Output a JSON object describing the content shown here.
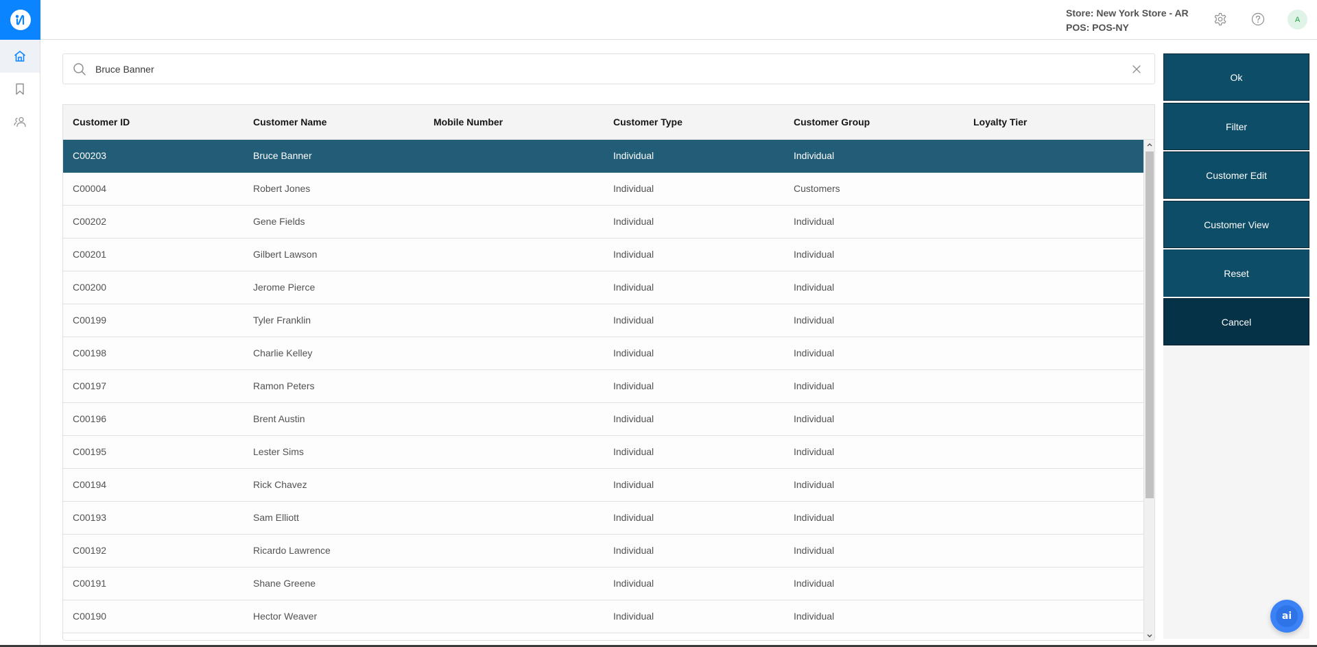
{
  "header": {
    "store_label": "Store: New York Store - AR",
    "pos_label": "POS: POS-NY",
    "avatar_initial": "A"
  },
  "sidebar": {
    "items": [
      {
        "name": "home",
        "icon": "home-icon",
        "active": true
      },
      {
        "name": "bookmarks",
        "icon": "bookmark-icon",
        "active": false
      },
      {
        "name": "customers",
        "icon": "users-icon",
        "active": false
      }
    ]
  },
  "search": {
    "value": "Bruce Banner",
    "placeholder": ""
  },
  "table": {
    "columns": [
      "Customer ID",
      "Customer Name",
      "Mobile Number",
      "Customer Type",
      "Customer Group",
      "Loyalty Tier"
    ],
    "selected_index": 0,
    "rows": [
      [
        "C00203",
        "Bruce Banner",
        "",
        "Individual",
        "Individual",
        ""
      ],
      [
        "C00004",
        "Robert Jones",
        "",
        "Individual",
        "Customers",
        ""
      ],
      [
        "C00202",
        "Gene Fields",
        "",
        "Individual",
        "Individual",
        ""
      ],
      [
        "C00201",
        "Gilbert Lawson",
        "",
        "Individual",
        "Individual",
        ""
      ],
      [
        "C00200",
        "Jerome Pierce",
        "",
        "Individual",
        "Individual",
        ""
      ],
      [
        "C00199",
        "Tyler Franklin",
        "",
        "Individual",
        "Individual",
        ""
      ],
      [
        "C00198",
        "Charlie Kelley",
        "",
        "Individual",
        "Individual",
        ""
      ],
      [
        "C00197",
        "Ramon Peters",
        "",
        "Individual",
        "Individual",
        ""
      ],
      [
        "C00196",
        "Brent Austin",
        "",
        "Individual",
        "Individual",
        ""
      ],
      [
        "C00195",
        "Lester Sims",
        "",
        "Individual",
        "Individual",
        ""
      ],
      [
        "C00194",
        "Rick Chavez",
        "",
        "Individual",
        "Individual",
        ""
      ],
      [
        "C00193",
        "Sam Elliott",
        "",
        "Individual",
        "Individual",
        ""
      ],
      [
        "C00192",
        "Ricardo Lawrence",
        "",
        "Individual",
        "Individual",
        ""
      ],
      [
        "C00191",
        "Shane Greene",
        "",
        "Individual",
        "Individual",
        ""
      ],
      [
        "C00190",
        "Hector Weaver",
        "",
        "Individual",
        "Individual",
        ""
      ]
    ]
  },
  "actions": {
    "ok": "Ok",
    "filter": "Filter",
    "customer_edit": "Customer Edit",
    "customer_view": "Customer View",
    "reset": "Reset",
    "cancel": "Cancel"
  },
  "assistant": {
    "label": "ai"
  },
  "colors": {
    "brand": "#0a84ff",
    "selected_row": "#225d78",
    "action_button": "#0e4d68",
    "cancel_button": "#053246",
    "assistant": "#3b82f6"
  }
}
